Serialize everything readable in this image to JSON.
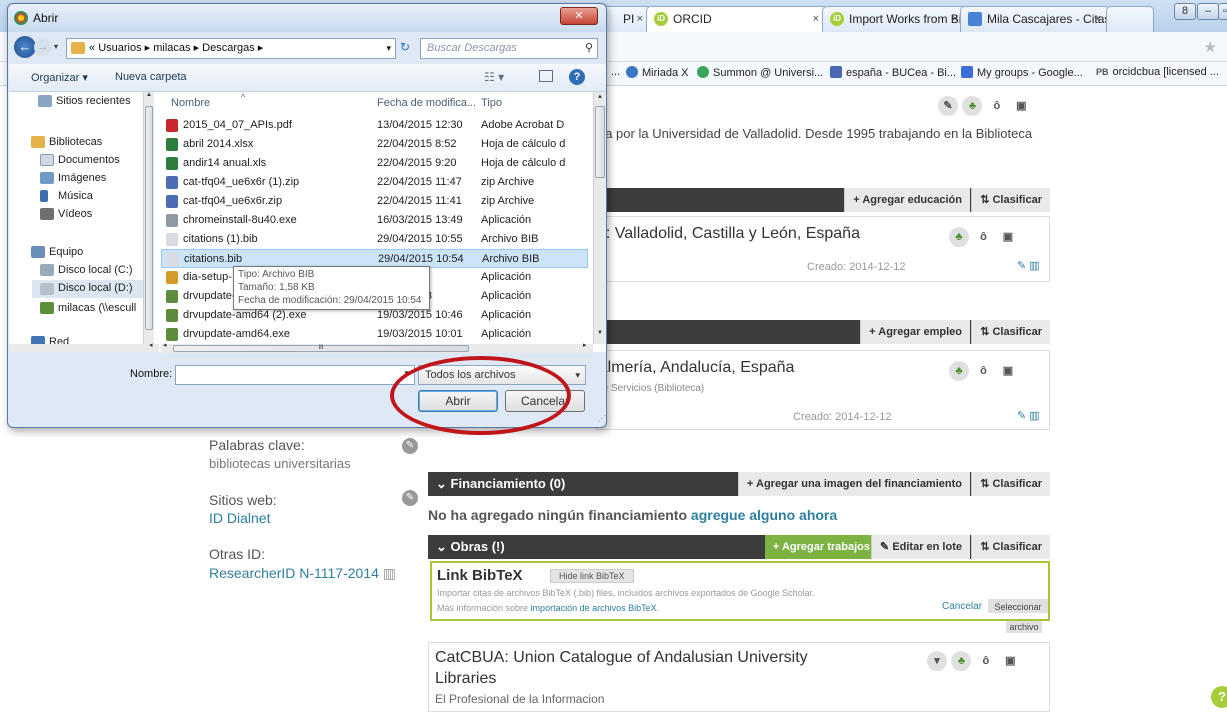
{
  "browser": {
    "tabs": [
      {
        "label": "PI",
        "icon": "page-icon",
        "active": false
      },
      {
        "label": "ORCID",
        "icon": "orcid-icon",
        "active": true
      },
      {
        "label": "Import Works from Bib",
        "icon": "orcid-icon",
        "active": false
      },
      {
        "label": "Mila Cascajares - Citas",
        "icon": "scholar-icon",
        "active": false
      }
    ],
    "tab_close": "×",
    "bookmarks": [
      {
        "label": "...",
        "color": "#999999"
      },
      {
        "label": "Miriada X",
        "color": "#3a75c4"
      },
      {
        "label": "Summon @ Universi...",
        "color": "#3aa55a"
      },
      {
        "label": "españa - BUCea - Bi...",
        "color": "#4a67b2"
      },
      {
        "label": "My groups - Google...",
        "color": "#3c6fd8"
      },
      {
        "label": "orcidcbua [licensed ...",
        "color": "#555555",
        "prefix": "PB"
      }
    ],
    "star": "★"
  },
  "orcid": {
    "bio_text": "ria por la Universidad de Valladolid. Desde 1995 trabajando en la Biblioteca",
    "education": {
      "add_label": "Agregar educación",
      "sort_label": "Clasificar",
      "entry_title": "d: Valladolid, Castilla y León, España",
      "created": "Creado: 2014-12-12"
    },
    "employment": {
      "add_label": "Agregar empleo",
      "sort_label": "Clasificar",
      "entry_title": "Almería, Andalucía, España",
      "entry_sub": "de Servicios (Biblioteca)",
      "created": "Creado: 2014-12-12"
    },
    "keywords": {
      "label": "Palabras clave:",
      "value": "bibliotecas universitarias"
    },
    "websites": {
      "label": "Sitios web:",
      "value": "ID Dialnet"
    },
    "other_ids": {
      "label": "Otras ID:",
      "value": "ResearcherID N-1117-2014"
    },
    "funding": {
      "header": "Financiamiento (0)",
      "add_label": "Agregar una imagen del financiamiento",
      "sort_label": "Clasificar",
      "empty_text": "No ha agregado ningún financiamiento",
      "empty_link": "agregue alguno ahora"
    },
    "works": {
      "header": "Obras (!)",
      "add_label": "Agregar trabajos",
      "edit_label": "Editar en lote",
      "sort_label": "Clasificar",
      "bibtex_title": "Link BibTeX",
      "hide_btn": "Hide link BibTeX",
      "bibtex_desc": "Importar citas de archivos BibTeX (.bib) files, incluidos archivos exportados de Google Scholar.",
      "bibtex_more_prefix": "Más información sobre",
      "bibtex_more_link": "importación de archivos BibTeX",
      "cancel": "Cancelar",
      "select_file_1": "Seleccionar",
      "select_file_2": "archivo"
    },
    "work_entry": {
      "title_1": "CatCBUA: Union Catalogue of Andalusian University",
      "title_2": "Libraries",
      "journal": "El Profesional de la Informacion"
    },
    "help": "?"
  },
  "dialog": {
    "title": "Abrir",
    "close": "✕",
    "path_prefix": "«",
    "path": [
      "Usuarios",
      "milacas",
      "Descargas"
    ],
    "search_placeholder": "Buscar Descargas",
    "organize": "Organizar ▾",
    "new_folder": "Nueva carpeta",
    "nav_pane": [
      {
        "label": "Sitios recientes",
        "color": "#8aa5c3",
        "indent": 1
      },
      {
        "label": "Bibliotecas",
        "color": "#e3b34a",
        "indent": 0
      },
      {
        "label": "Documentos",
        "color": "#cfd9e6",
        "indent": 1
      },
      {
        "label": "Imágenes",
        "color": "#6f9bc6",
        "indent": 1
      },
      {
        "label": "Música",
        "color": "#3a6fb0",
        "indent": 1
      },
      {
        "label": "Vídeos",
        "color": "#6f6f6f",
        "indent": 1
      },
      {
        "label": "Equipo",
        "color": "#6a8fb7",
        "indent": 0
      },
      {
        "label": "Disco local (C:)",
        "color": "#9aa9b8",
        "indent": 1
      },
      {
        "label": "Disco local (D:)",
        "color": "#b7c0c8",
        "indent": 1
      },
      {
        "label": "milacas (\\\\escull",
        "color": "#5c8f3c",
        "indent": 1
      },
      {
        "label": "Red",
        "color": "#3f75b5",
        "indent": 0
      }
    ],
    "columns": {
      "name": "Nombre",
      "date": "Fecha de modifica...",
      "type": "Tipo"
    },
    "files": [
      {
        "name": "2015_04_07_APIs.pdf",
        "date": "13/04/2015 12:30",
        "type": "Adobe Acrobat D",
        "color": "#c8282c"
      },
      {
        "name": "abril 2014.xlsx",
        "date": "22/04/2015 8:52",
        "type": "Hoja de cálculo d",
        "color": "#2f7d3c"
      },
      {
        "name": "andir14 anual.xls",
        "date": "22/04/2015 9:20",
        "type": "Hoja de cálculo d",
        "color": "#2f7d3c"
      },
      {
        "name": "cat-tfq04_ue6x6r (1).zip",
        "date": "22/04/2015 11:47",
        "type": "zip Archive",
        "color": "#4a6db5"
      },
      {
        "name": "cat-tfq04_ue6x6r.zip",
        "date": "22/04/2015 11:41",
        "type": "zip Archive",
        "color": "#4a6db5"
      },
      {
        "name": "chromeinstall-8u40.exe",
        "date": "16/03/2015 13:49",
        "type": "Aplicación",
        "color": "#8f9aa5"
      },
      {
        "name": "citations (1).bib",
        "date": "29/04/2015 10:55",
        "type": "Archivo BIB",
        "color": "#d8dce2"
      },
      {
        "name": "citations.bib",
        "date": "29/04/2015 10:54",
        "type": "Archivo BIB",
        "color": "#d8dce2"
      },
      {
        "name": "dia-setup-",
        "date": "2015 9:02",
        "type": "Aplicación",
        "color": "#d39b2a"
      },
      {
        "name": "drvupdate-",
        "date": "2015 10:33",
        "type": "Aplicación",
        "color": "#5d8d3c"
      },
      {
        "name": "drvupdate-amd64 (2).exe",
        "date": "19/03/2015 10:46",
        "type": "Aplicación",
        "color": "#5d8d3c"
      },
      {
        "name": "drvupdate-amd64.exe",
        "date": "19/03/2015 10:01",
        "type": "Aplicación",
        "color": "#5d8d3c"
      }
    ],
    "selected_index": 7,
    "tooltip": [
      "Tipo: Archivo BIB",
      "Tamaño: 1,58 KB",
      "Fecha de modificación: 29/04/2015 10:54"
    ],
    "hscroll_grip": "III",
    "filename_label": "Nombre:",
    "filename_value": "",
    "filter": "Todos los archivos",
    "open_btn": "Abrir",
    "cancel_btn": "Cancelar"
  },
  "annotation_color": "#c0151b"
}
